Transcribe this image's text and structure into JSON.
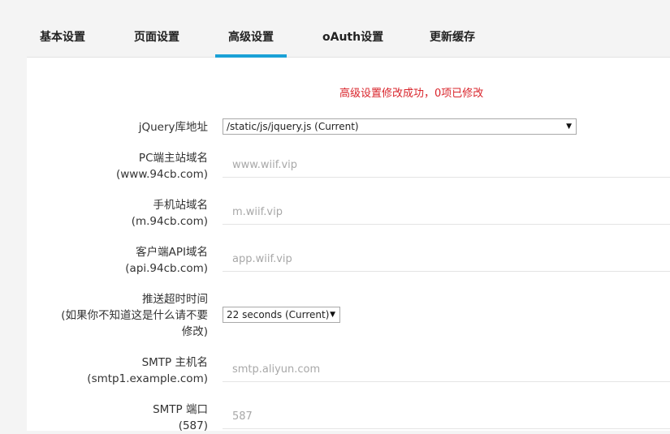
{
  "tabs": [
    {
      "label": "基本设置",
      "active": false
    },
    {
      "label": "页面设置",
      "active": false
    },
    {
      "label": "高级设置",
      "active": true
    },
    {
      "label": "oAuth设置",
      "active": false
    },
    {
      "label": "更新缓存",
      "active": false
    }
  ],
  "accent_color": "#1aa1d6",
  "success_message": "高级设置修改成功，0项已修改",
  "fields": {
    "jquery": {
      "label": "jQuery库地址",
      "value": "/static/js/jquery.js (Current)"
    },
    "pc_domain": {
      "label_line1": "PC端主站域名",
      "label_line2": "(www.94cb.com)",
      "placeholder": "www.wiif.vip"
    },
    "mobile_domain": {
      "label_line1": "手机站域名",
      "label_line2": "(m.94cb.com)",
      "placeholder": "m.wiif.vip"
    },
    "api_domain": {
      "label_line1": "客户端API域名",
      "label_line2": "(api.94cb.com)",
      "placeholder": "app.wiif.vip"
    },
    "push_timeout": {
      "label_line1": "推送超时时间",
      "label_line2": "(如果你不知道这是什么请不要",
      "label_line3": "修改)",
      "value": "22 seconds (Current)"
    },
    "smtp_host": {
      "label_line1": "SMTP 主机名",
      "label_line2": "(smtp1.example.com)",
      "placeholder": "smtp.aliyun.com"
    },
    "smtp_port": {
      "label_line1": "SMTP 端口",
      "label_line2": "(587)",
      "placeholder": "587"
    }
  }
}
